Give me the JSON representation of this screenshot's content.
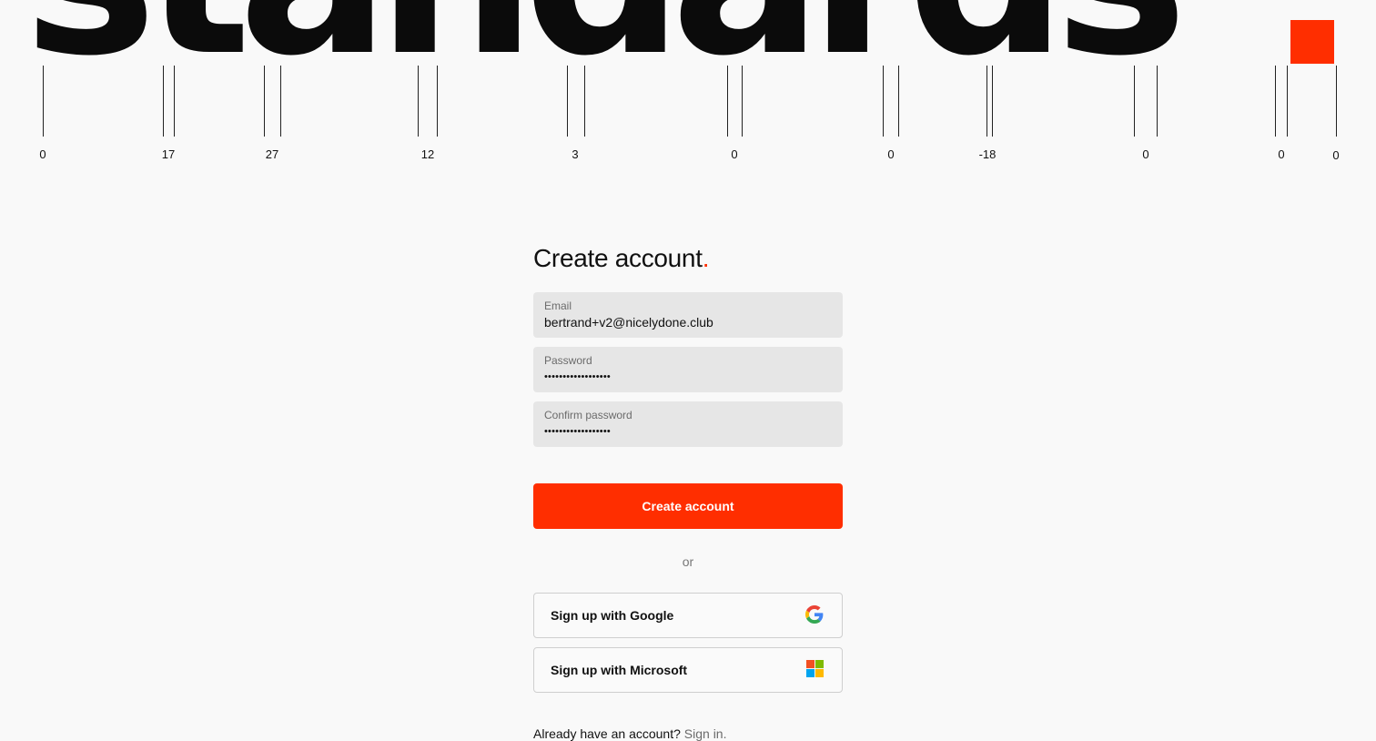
{
  "hero": {
    "word": "standards",
    "kerning_values": [
      "0",
      "17",
      "27",
      "12",
      "3",
      "0",
      "0",
      "-18",
      "0",
      "0",
      "0"
    ]
  },
  "form": {
    "title": "Create account",
    "title_dot": ".",
    "email": {
      "label": "Email",
      "value": "bertrand+v2@nicelydone.club"
    },
    "password": {
      "label": "Password",
      "value": "••••••••••••••••••"
    },
    "confirm_password": {
      "label": "Confirm password",
      "value": "••••••••••••••••••"
    },
    "submit_label": "Create account",
    "divider_text": "or",
    "google_label": "Sign up with Google",
    "microsoft_label": "Sign up with Microsoft",
    "signin_prompt": "Already have an account?",
    "signin_link": "Sign in."
  },
  "icons": {
    "google": "google-logo-icon",
    "microsoft": "microsoft-logo-icon"
  },
  "colors": {
    "accent": "#ff2e00",
    "field_bg": "#e6e6e6",
    "background": "#f9f9f9"
  }
}
